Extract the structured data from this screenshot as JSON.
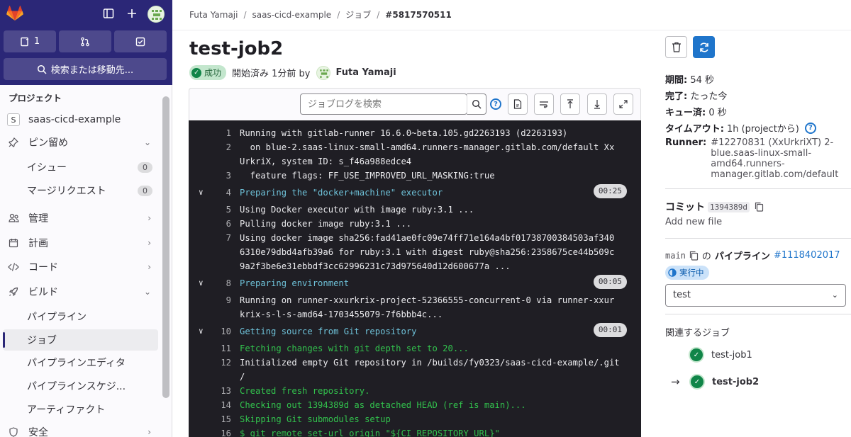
{
  "sidebar": {
    "counts": {
      "issues": "1"
    },
    "search_label": "検索または移動先...",
    "section_title": "プロジェクト",
    "project": {
      "initial": "S",
      "name": "saas-cicd-example"
    },
    "items": [
      {
        "label": "ピン留め"
      },
      {
        "label": "イシュー",
        "badge": "0"
      },
      {
        "label": "マージリクエスト",
        "badge": "0"
      },
      {
        "label": "管理"
      },
      {
        "label": "計画"
      },
      {
        "label": "コード"
      },
      {
        "label": "ビルド"
      },
      {
        "label": "パイプライン"
      },
      {
        "label": "ジョブ"
      },
      {
        "label": "パイプラインエディタ"
      },
      {
        "label": "パイプラインスケジ..."
      },
      {
        "label": "アーティファクト"
      },
      {
        "label": "安全"
      }
    ]
  },
  "breadcrumb": [
    "Futa Yamaji",
    "saas-cicd-example",
    "ジョブ",
    "#5817570511"
  ],
  "job": {
    "title": "test-job2",
    "status": "成功",
    "started": "開始済み 1分前 by",
    "user": "Futa Yamaji"
  },
  "log_toolbar": {
    "search_placeholder": "ジョブログを検索"
  },
  "log_lines": [
    {
      "n": "1",
      "text": "Running with gitlab-runner 16.6.0~beta.105.gd2263193 (d2263193)",
      "cls": "wh"
    },
    {
      "n": "2",
      "text": "  on blue-2.saas-linux-small-amd64.runners-manager.gitlab.com/default Xx",
      "cls": "wh"
    },
    {
      "n": "",
      "text": "UrkriX, system ID: s_f46a988edce4",
      "cls": "wh"
    },
    {
      "n": "3",
      "text": "  feature flags: FF_USE_IMPROVED_URL_MASKING:true",
      "cls": "wh"
    },
    {
      "n": "4",
      "text": "Preparing the \"docker+machine\" executor",
      "cls": "cyan",
      "collapse": true,
      "dur": "00:25"
    },
    {
      "n": "5",
      "text": "Using Docker executor with image ruby:3.1 ...",
      "cls": "wh"
    },
    {
      "n": "6",
      "text": "Pulling docker image ruby:3.1 ...",
      "cls": "wh"
    },
    {
      "n": "7",
      "text": "Using docker image sha256:fad41ae0fc09e74ff71e164a4bf01738700384503af340",
      "cls": "wh"
    },
    {
      "n": "",
      "text": "6310e79dbd4afb39a6 for ruby:3.1 with digest ruby@sha256:2358675ce44b509c",
      "cls": "wh"
    },
    {
      "n": "",
      "text": "9a2f3be6e31ebbdf3cc62996231c73d975640d12d600677a ...",
      "cls": "wh"
    },
    {
      "n": "8",
      "text": "Preparing environment",
      "cls": "cyan",
      "collapse": true,
      "dur": "00:05"
    },
    {
      "n": "9",
      "text": "Running on runner-xxurkrix-project-52366555-concurrent-0 via runner-xxur",
      "cls": "wh"
    },
    {
      "n": "",
      "text": "krix-s-l-s-amd64-1703455079-7f6bbb4c...",
      "cls": "wh"
    },
    {
      "n": "10",
      "text": "Getting source from Git repository",
      "cls": "cyan",
      "collapse": true,
      "dur": "00:01"
    },
    {
      "n": "11",
      "text": "Fetching changes with git depth set to 20...",
      "cls": "grn"
    },
    {
      "n": "12",
      "text": "Initialized empty Git repository in /builds/fy0323/saas-cicd-example/.git",
      "cls": "wh"
    },
    {
      "n": "",
      "text": "/",
      "cls": "wh"
    },
    {
      "n": "13",
      "text": "Created fresh repository.",
      "cls": "grn"
    },
    {
      "n": "14",
      "text": "Checking out 1394389d as detached HEAD (ref is main)...",
      "cls": "grn"
    },
    {
      "n": "15",
      "text": "Skipping Git submodules setup",
      "cls": "grn"
    },
    {
      "n": "16",
      "text": "$ git remote set-url origin \"${CI_REPOSITORY_URL}\"",
      "cls": "grn"
    }
  ],
  "details": {
    "duration_label": "期間:",
    "duration": "54 秒",
    "finished_label": "完了:",
    "finished": "たった今",
    "queued_label": "キュー済:",
    "queued": "0 秒",
    "timeout_label": "タイムアウト:",
    "timeout": "1h (projectから)",
    "runner_label": "Runner:",
    "runner_lines": [
      "#12270831 (XxUrkriXT) 2-",
      "blue.saas-linux-small-",
      "amd64.runners-",
      "manager.gitlab.com/default"
    ]
  },
  "commit": {
    "label": "コミット",
    "sha": "1394389d",
    "message": "Add new file"
  },
  "pipeline": {
    "ref": "main",
    "of": "の",
    "label": "パイプライン",
    "id": "#1118402017",
    "status": "実行中",
    "stage": "test"
  },
  "related": {
    "title": "関連するジョブ",
    "jobs": [
      "test-job1",
      "test-job2"
    ]
  }
}
